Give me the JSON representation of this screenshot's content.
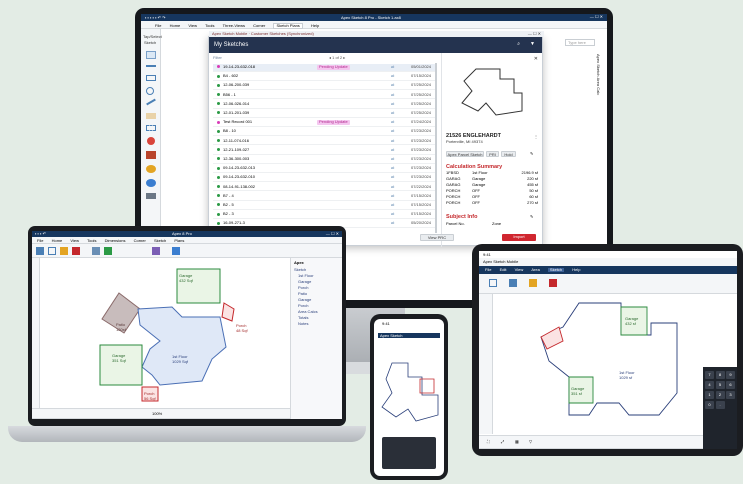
{
  "desktop": {
    "app_title": "Apex Sketch 8 Pro - Sketch 1.ax8",
    "tabs": [
      "File",
      "Home",
      "View",
      "Tools",
      "Three-Views",
      "Corner",
      "Sketch Plans",
      "Help"
    ],
    "active_tab": "Sketch Plans",
    "search_placeholder": "Type here",
    "left_labels": [
      "Tap/Select",
      "Sketch"
    ],
    "right_labels": [
      "Apex",
      "Sketch",
      "Area",
      "Calc"
    ],
    "dialog": {
      "title": "My Sketches",
      "window_title": "Apex Sketch Mobile · Customer Sketches (Synchronized)",
      "filter_label": "Filter",
      "pagination": "1 of 2",
      "rows": [
        {
          "name": "19-14-23-632-018",
          "status": "Pending Update",
          "date": "05/01/2024",
          "dot": "#d93bb8"
        },
        {
          "name": "B4 - 602",
          "status": "",
          "date": "07/15/2024",
          "dot": "#2b9a45"
        },
        {
          "name": "12-06-200-039",
          "status": "",
          "date": "07/25/2024",
          "dot": "#2b9a45"
        },
        {
          "name": "B56 - 1",
          "status": "",
          "date": "07/25/2024",
          "dot": "#2b9a45"
        },
        {
          "name": "12-06-026-014",
          "status": "",
          "date": "07/25/2024",
          "dot": "#2b9a45"
        },
        {
          "name": "12-01-201-039",
          "status": "",
          "date": "07/25/2024",
          "dot": "#2b9a45"
        },
        {
          "name": "Test Record 001",
          "status": "Pending Update",
          "date": "07/24/2024",
          "dot": "#d93bb8"
        },
        {
          "name": "B8 - 10",
          "status": "",
          "date": "07/23/2024",
          "dot": "#2b9a45"
        },
        {
          "name": "12-11-074-016",
          "status": "",
          "date": "07/23/2024",
          "dot": "#2b9a45"
        },
        {
          "name": "12-21-109-027",
          "status": "",
          "date": "07/23/2024",
          "dot": "#2b9a45"
        },
        {
          "name": "12-36-300-003",
          "status": "",
          "date": "07/23/2024",
          "dot": "#2b9a45"
        },
        {
          "name": "09-14-23-632-013",
          "status": "",
          "date": "07/23/2024",
          "dot": "#2b9a45"
        },
        {
          "name": "09-14-23-632-010",
          "status": "",
          "date": "07/23/2024",
          "dot": "#2b9a45"
        },
        {
          "name": "08-14-91-138-002",
          "status": "",
          "date": "07/22/2024",
          "dot": "#2b9a45"
        },
        {
          "name": "B7 - 4",
          "status": "",
          "date": "07/15/2024",
          "dot": "#2b9a45"
        },
        {
          "name": "B2 - 5",
          "status": "",
          "date": "07/15/2024",
          "dot": "#2b9a45"
        },
        {
          "name": "B2 - 3",
          "status": "",
          "date": "07/15/2024",
          "dot": "#2b9a45"
        },
        {
          "name": "16-09-271-3",
          "status": "",
          "date": "05/20/2024",
          "dot": "#2b9a45"
        }
      ],
      "detail": {
        "address": "21526 ENGLEHARDT",
        "city": "Porterville, MI 49374",
        "buttons": [
          "Apex Parcel Sketch",
          "PRI",
          "Hold"
        ],
        "calc_title": "Calculation Summary",
        "calc_rows": [
          [
            "1FBSD",
            "1st Floor",
            "2196.9 sf"
          ],
          [
            "GARAG",
            "Garage",
            "220 sf"
          ],
          [
            "GARAG",
            "Garage",
            "455 sf"
          ],
          [
            "PORCH",
            "OFF",
            "50 sf"
          ],
          [
            "PORCH",
            "OFF",
            "60 sf"
          ],
          [
            "PORCH",
            "OFF",
            "270 sf"
          ]
        ],
        "subject_title": "Subject Info",
        "subject_label": "Parcel No.",
        "subject_value": "Zone",
        "view_btn": "View PRC",
        "import_btn": "Import"
      }
    }
  },
  "laptop": {
    "app_title": "Apex 8 Pro",
    "tabs": [
      "File",
      "Home",
      "View",
      "Tools",
      "Dimensions",
      "Corner",
      "Sketch",
      "Plans"
    ],
    "rooms": [
      {
        "name": "Garage",
        "area": "432 Sqf"
      },
      {
        "name": "Patio",
        "area": "120sf"
      },
      {
        "name": "Porch",
        "area": "48 Sqf"
      },
      {
        "name": "Garage",
        "area": "351 Sqf"
      },
      {
        "name": "1st Floor",
        "area": "1029 Sqf"
      },
      {
        "name": "Porch",
        "area": "56 Sqf"
      }
    ],
    "panel_title": "Apex",
    "panel_items": [
      "Sketch",
      "1st Floor",
      "Garage",
      "Porch",
      "Patio",
      "Garage",
      "Porch",
      "Area Calcs",
      "Totals",
      "Notes"
    ],
    "zoom": "100%"
  },
  "phone": {
    "time": "9:41",
    "app_title": "Apex Sketch"
  },
  "tablet": {
    "time": "9:41",
    "app_title": "Apex Sketch Mobile",
    "tabs": [
      "File",
      "Edit",
      "View",
      "Area",
      "Sketch",
      "Help"
    ],
    "active_tab": "Sketch",
    "rooms": [
      {
        "name": "Garage",
        "area": "432 sf"
      },
      {
        "name": "1st Floor",
        "area": "1029 sf"
      },
      {
        "name": "Garage",
        "area": "351 sf"
      }
    ],
    "keypad": [
      "7",
      "8",
      "9",
      "4",
      "5",
      "6",
      "1",
      "2",
      "3",
      "0",
      "."
    ]
  }
}
